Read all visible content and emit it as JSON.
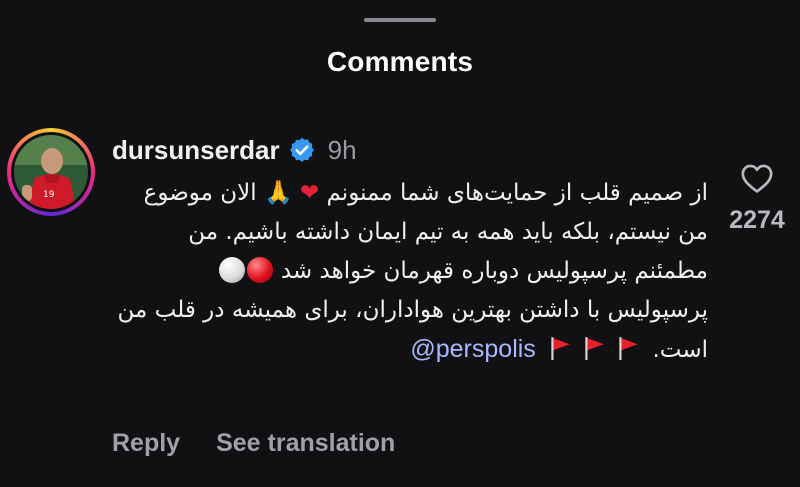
{
  "sheet": {
    "title": "Comments"
  },
  "comment": {
    "username": "dursunserdar",
    "verified": true,
    "time": "9h",
    "lines": [
      "از صمیم قلب از حمایت‌های شما ممنونم",
      "الان موضوع من نیستم، بلکه باید همه به تیم ایمان داشته باشیم. من مطمئنم پرسپولیس دوباره قهرمان خواهد شد",
      "پرسپولیس با داشتن بهترین هواداران، برای همیشه در قلب من است."
    ],
    "mention": "@perspolis",
    "emoji": {
      "heart": "❤",
      "pray": "🙏"
    },
    "like_count": "2274"
  },
  "actions": {
    "reply": "Reply",
    "see_translation": "See translation"
  },
  "colors": {
    "background": "#111113",
    "mention": "#a9b8ff",
    "verified": "#3897f0",
    "muted": "#a0a0a6"
  },
  "icons": {
    "verified": "verified-badge-icon",
    "like": "heart-outline-icon",
    "flag": "triangular-flag-icon"
  }
}
